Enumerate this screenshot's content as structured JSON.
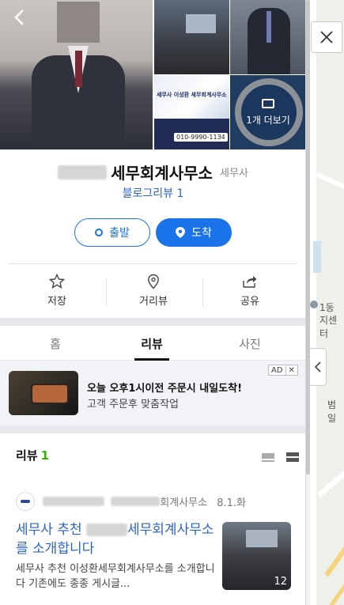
{
  "place": {
    "name": "세무회계사무소",
    "category": "세무사",
    "blog_review": "블로그리뷰 1"
  },
  "photos": {
    "more_label": "1개 더보기",
    "banner_title": "세무사 이성환 세무회계사무소",
    "banner_phone": "010-9990-1134"
  },
  "buttons": {
    "start": "출발",
    "arrive": "도착"
  },
  "actions": {
    "save": "저장",
    "street_view": "거리뷰",
    "share": "공유"
  },
  "tabs": {
    "home": "홈",
    "review": "리뷰",
    "photo": "사진"
  },
  "ad": {
    "title": "오늘 오후1시이전 주문시 내일도착!",
    "subtitle": "고객 주문후 맞춤작업",
    "badge": "AD",
    "close": "✕"
  },
  "reviews": {
    "header": "리뷰",
    "count": "1",
    "item": {
      "author_suffix": "회계사무소",
      "date": "8.1.화",
      "title_prefix": "세무사 추천",
      "title_suffix": "세무회계사무소를 소개합니다",
      "body": "세무사 추천 이성환세무회계사무소를 소개합니다 기존에도 종종 게시글...",
      "photo_count": "12"
    }
  },
  "map": {
    "label1": "1동",
    "label2": "지센터",
    "label3": "범일",
    "label4": "!"
  },
  "colors": {
    "accent": "#1a73e8",
    "link": "#2c63c8",
    "review_count": "#2db400"
  }
}
